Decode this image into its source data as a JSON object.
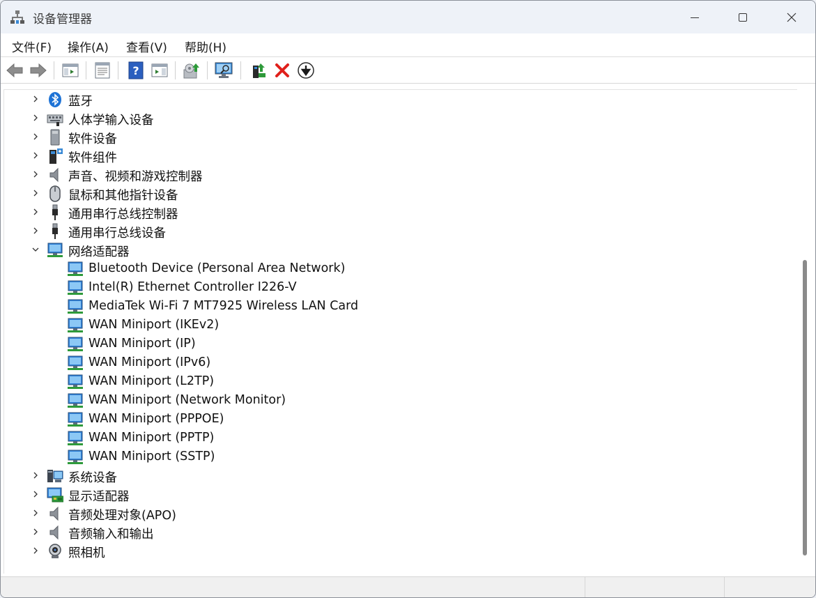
{
  "window": {
    "title": "设备管理器",
    "icon": "device-manager-icon"
  },
  "menu": [
    {
      "label": "文件(F)"
    },
    {
      "label": "操作(A)"
    },
    {
      "label": "查看(V)"
    },
    {
      "label": "帮助(H)"
    }
  ],
  "toolbar": [
    {
      "name": "back-button",
      "icon": "arrow-left-icon"
    },
    {
      "name": "forward-button",
      "icon": "arrow-right-icon"
    },
    {
      "name": "show-hide-console-tree-button",
      "icon": "console-tree-icon"
    },
    {
      "name": "properties-button",
      "icon": "properties-sheet-icon"
    },
    {
      "name": "help-button",
      "icon": "help-icon"
    },
    {
      "name": "action-pane-button",
      "icon": "action-pane-icon"
    },
    {
      "name": "update-driver-button",
      "icon": "update-driver-icon"
    },
    {
      "name": "scan-hardware-button",
      "icon": "scan-monitor-icon"
    },
    {
      "name": "enable-device-button",
      "icon": "add-device-icon"
    },
    {
      "name": "uninstall-device-button",
      "icon": "red-x-icon"
    },
    {
      "name": "disable-device-button",
      "icon": "down-arrow-circle-icon"
    }
  ],
  "tree": [
    {
      "label": "蓝牙",
      "icon": "bluetooth-icon",
      "level": 0,
      "state": "collapsed"
    },
    {
      "label": "人体学输入设备",
      "icon": "hid-keyboard-icon",
      "level": 0,
      "state": "collapsed"
    },
    {
      "label": "软件设备",
      "icon": "software-device-icon",
      "level": 0,
      "state": "collapsed"
    },
    {
      "label": "软件组件",
      "icon": "software-component-icon",
      "level": 0,
      "state": "collapsed"
    },
    {
      "label": "声音、视频和游戏控制器",
      "icon": "speaker-icon",
      "level": 0,
      "state": "collapsed"
    },
    {
      "label": "鼠标和其他指针设备",
      "icon": "mouse-icon",
      "level": 0,
      "state": "collapsed"
    },
    {
      "label": "通用串行总线控制器",
      "icon": "usb-icon",
      "level": 0,
      "state": "collapsed"
    },
    {
      "label": "通用串行总线设备",
      "icon": "usb-icon",
      "level": 0,
      "state": "collapsed"
    },
    {
      "label": "网络适配器",
      "icon": "network-adapter-icon",
      "level": 0,
      "state": "expanded"
    },
    {
      "label": "Bluetooth Device (Personal Area Network)",
      "icon": "network-adapter-icon",
      "level": 1
    },
    {
      "label": "Intel(R) Ethernet Controller I226-V",
      "icon": "network-adapter-icon",
      "level": 1
    },
    {
      "label": "MediaTek Wi-Fi 7 MT7925 Wireless LAN Card",
      "icon": "network-adapter-icon",
      "level": 1
    },
    {
      "label": "WAN Miniport (IKEv2)",
      "icon": "network-adapter-icon",
      "level": 1
    },
    {
      "label": "WAN Miniport (IP)",
      "icon": "network-adapter-icon",
      "level": 1
    },
    {
      "label": "WAN Miniport (IPv6)",
      "icon": "network-adapter-icon",
      "level": 1
    },
    {
      "label": "WAN Miniport (L2TP)",
      "icon": "network-adapter-icon",
      "level": 1
    },
    {
      "label": "WAN Miniport (Network Monitor)",
      "icon": "network-adapter-icon",
      "level": 1
    },
    {
      "label": "WAN Miniport (PPPOE)",
      "icon": "network-adapter-icon",
      "level": 1
    },
    {
      "label": "WAN Miniport (PPTP)",
      "icon": "network-adapter-icon",
      "level": 1
    },
    {
      "label": "WAN Miniport (SSTP)",
      "icon": "network-adapter-icon",
      "level": 1
    },
    {
      "label": "系统设备",
      "icon": "system-device-icon",
      "level": 0,
      "state": "collapsed"
    },
    {
      "label": "显示适配器",
      "icon": "display-adapter-icon",
      "level": 0,
      "state": "collapsed"
    },
    {
      "label": "音频处理对象(APO)",
      "icon": "speaker-icon",
      "level": 0,
      "state": "collapsed"
    },
    {
      "label": "音频输入和输出",
      "icon": "speaker-icon",
      "level": 0,
      "state": "collapsed"
    },
    {
      "label": "照相机",
      "icon": "camera-icon",
      "level": 0,
      "state": "collapsed"
    }
  ],
  "colors": {
    "accent": "#0067c0",
    "close_red": "#e0201b",
    "titlebar_bg": "#eef2f8"
  }
}
